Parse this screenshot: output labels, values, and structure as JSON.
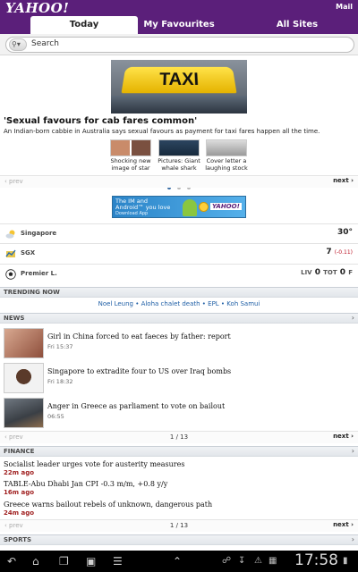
{
  "app": {
    "logo": "YAHOO!",
    "mail_label": "Mail"
  },
  "tabs": [
    {
      "label": "Today"
    },
    {
      "label": "My Favourites"
    },
    {
      "label": "All Sites"
    }
  ],
  "search": {
    "placeholder": "Search"
  },
  "hero": {
    "image_text": "TAXI",
    "headline": "'Sexual favours for cab fares common'",
    "subline": "An Indian-born cabbie in Australia says sexual favours as payment for taxi fares happen all the time.",
    "thumbs": [
      {
        "caption_1": "Shocking new",
        "caption_2": "image of star"
      },
      {
        "caption_1": "Pictures: Giant",
        "caption_2": "whale shark"
      },
      {
        "caption_1": "Cover letter a",
        "caption_2": "laughing stock"
      }
    ],
    "prev_label": "‹ prev",
    "next_label": "next ›"
  },
  "ad": {
    "line1": "The IM and",
    "line2": "Android™ you love",
    "line3": "Download App",
    "brand": "YAHOO!"
  },
  "info": {
    "weather": {
      "label": "Singapore",
      "value": "30°"
    },
    "stock": {
      "label": "SGX",
      "value": "7",
      "change": "(-0.11)"
    },
    "sport": {
      "label": "Premier L.",
      "home": "LIV",
      "home_score": "0",
      "away": "TOT",
      "away_score": "0",
      "status": "F"
    }
  },
  "trending": {
    "title": "TRENDING NOW",
    "links": [
      "Noel Leung",
      "Aloha chalet death",
      "EPL",
      "Koh Samui"
    ],
    "sep": " • "
  },
  "news": {
    "title": "NEWS",
    "items": [
      {
        "title": "Girl in China forced to eat faeces by father: report",
        "date": "Fri 15:37"
      },
      {
        "title": "Singapore to extradite four to US over Iraq bombs",
        "date": "Fri 18:32"
      },
      {
        "title": "Anger in Greece as parliament to vote on bailout",
        "date": "06:55"
      }
    ],
    "prev_label": "‹ prev",
    "page": "1 / 13",
    "next_label": "next ›"
  },
  "finance": {
    "title": "FINANCE",
    "items": [
      {
        "title": "Socialist leader urges vote for austerity measures",
        "age": "22m ago"
      },
      {
        "title": "TABLE-Abu Dhabi Jan CPI -0.3 m/m, +0.8 y/y",
        "age": "16m ago"
      },
      {
        "title": "Greece warns bailout rebels of unknown, dangerous path",
        "age": "24m ago"
      }
    ],
    "prev_label": "‹ prev",
    "page": "1 / 13",
    "next_label": "next ›"
  },
  "sports": {
    "title": "SPORTS"
  },
  "system": {
    "time": "17:58"
  },
  "colors": {
    "brand": "#5b1f7a",
    "link": "#1f5fa6",
    "finance_age": "#a02020"
  }
}
